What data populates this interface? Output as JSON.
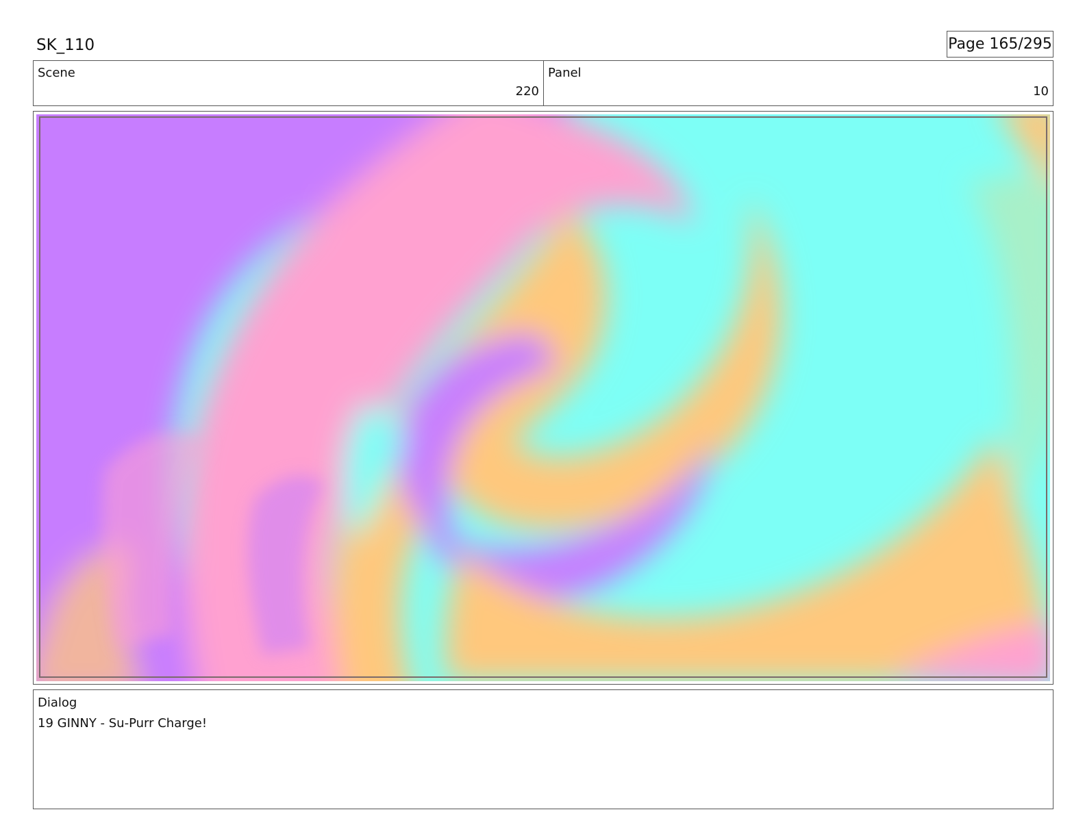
{
  "header": {
    "title": "SK_110",
    "page_label": "Page 165/295"
  },
  "info": {
    "scene_label": "Scene",
    "scene_value": "220",
    "panel_label": "Panel",
    "panel_value": "10"
  },
  "artwork": {
    "colors": {
      "violet": "#c77dff",
      "pink": "#ffa1d0",
      "peach": "#ffc87d",
      "cyan": "#7dfff6",
      "mint": "#a8f0c8"
    }
  },
  "dialog": {
    "label": "Dialog",
    "text": "19 GINNY - Su-Purr Charge!"
  }
}
